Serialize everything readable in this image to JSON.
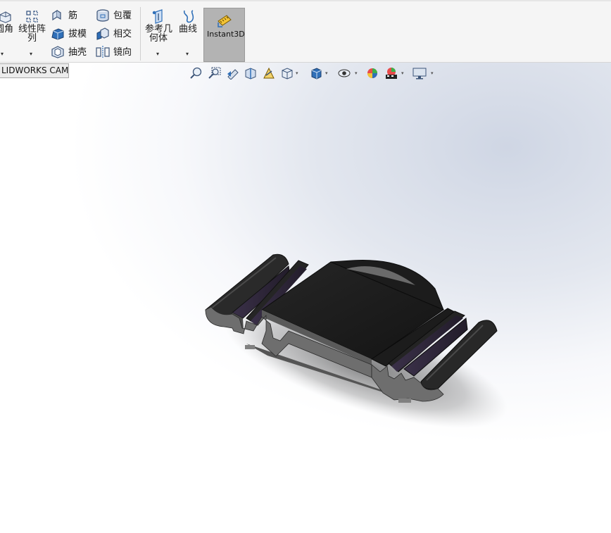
{
  "ribbon": {
    "fillet_label": "圆角",
    "linear_pattern_label_1": "线性阵",
    "linear_pattern_label_2": "列",
    "rib_label": "筋",
    "draft_label": "拔模",
    "shell_label": "抽壳",
    "wrap_label": "包覆",
    "intersect_label": "相交",
    "mirror_label": "镜向",
    "ref_geometry_label_1": "参考几",
    "ref_geometry_label_2": "何体",
    "curves_label": "曲线",
    "instant3d_label": "Instant3D",
    "caret": "▾"
  },
  "tabs": {
    "cam_tab": "LIDWORKS CAM"
  },
  "heads_up_toolbar": {
    "icons": [
      "zoom-to-fit-icon",
      "zoom-to-area-icon",
      "previous-view-icon",
      "section-view-icon",
      "dynamic-annotation-icon",
      "view-orientation-icon",
      "display-style-icon",
      "hide-show-items-icon",
      "edit-appearance-icon",
      "apply-scene-icon",
      "view-settings-icon"
    ]
  },
  "colors": {
    "model_dark": "#2b2b2b",
    "model_side": "#3a3a3a",
    "model_face": "#181818",
    "instant3d_bg": "#b3b3b3"
  }
}
